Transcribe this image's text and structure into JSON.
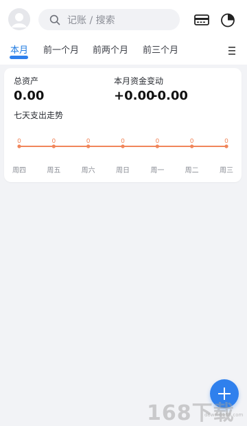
{
  "header": {
    "search_placeholder": "记账 / 搜索",
    "icons": [
      "avatar",
      "search-icon",
      "wallet-icon",
      "pie-chart-icon"
    ]
  },
  "tabs": [
    {
      "label": "本月",
      "active": true
    },
    {
      "label": "前一个月",
      "active": false
    },
    {
      "label": "前两个月",
      "active": false
    },
    {
      "label": "前三个月",
      "active": false
    }
  ],
  "summary": {
    "total_assets_label": "总资产",
    "total_assets_value": "0.00",
    "monthly_change_label": "本月资金变动",
    "income_value": "+0.00",
    "expense_value": "-0.00",
    "trend_label": "七天支出走势"
  },
  "chart_data": {
    "type": "line",
    "categories": [
      "周四",
      "周五",
      "周六",
      "周日",
      "周一",
      "周二",
      "周三"
    ],
    "values": [
      0,
      0,
      0,
      0,
      0,
      0,
      0
    ],
    "point_labels": [
      "0",
      "0",
      "0",
      "0",
      "0",
      "0",
      "0"
    ],
    "color": "#f0855a",
    "grid": false,
    "legend": "none"
  },
  "fab": {
    "icon": "plus-icon"
  },
  "watermark": {
    "text": "168下载",
    "sub": "down.it168.com"
  },
  "colors": {
    "accent": "#2f80ed",
    "chart_line": "#f0855a",
    "background": "#f2f3f6"
  }
}
